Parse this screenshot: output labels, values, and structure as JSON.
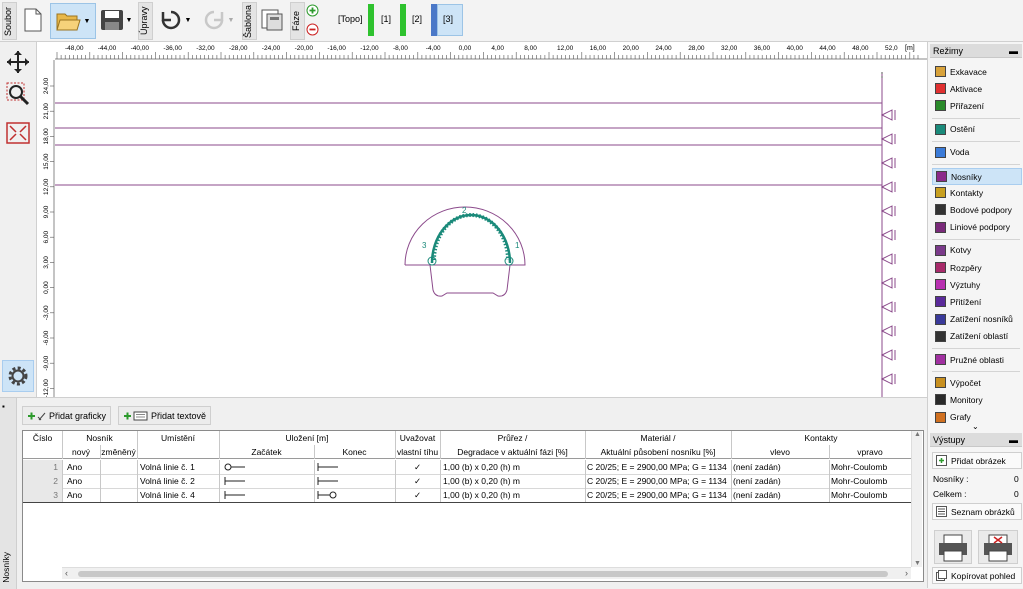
{
  "toolbar": {
    "file_label": "Soubor",
    "edit_label": "Úpravy",
    "template_label": "Šablona",
    "phase_label": "Fáze",
    "stages": [
      "[Topo]",
      "[1]",
      "[2]",
      "[3]"
    ],
    "active_stage": "[3]"
  },
  "ruler": {
    "ticks": [
      "-48,00",
      "-44,00",
      "-40,00",
      "-36,00",
      "-32,00",
      "-28,00",
      "-24,00",
      "-20,00",
      "-16,00",
      "-12,00",
      "-8,00",
      "-4,00",
      "0,00",
      "4,00",
      "8,00",
      "12,00",
      "16,00",
      "20,00",
      "24,00",
      "28,00",
      "32,00",
      "36,00",
      "40,00",
      "44,00",
      "48,00",
      "52,0"
    ],
    "unit": "[m]",
    "vticks": [
      "24,00",
      "21,00",
      "18,00",
      "15,00",
      "12,00",
      "9,00",
      "6,00",
      "3,00",
      "0,00",
      "-3,00",
      "-6,00",
      "-9,00",
      "-12,00"
    ]
  },
  "drawing": {
    "beam_labels": [
      "1",
      "2",
      "3"
    ]
  },
  "right_panel": {
    "modes_title": "Režimy",
    "modes": [
      {
        "label": "Exkavace",
        "icon": "excavation-icon"
      },
      {
        "label": "Aktivace",
        "icon": "activation-icon"
      },
      {
        "label": "Přiřazení",
        "icon": "assignment-icon"
      },
      {
        "label": "Ostění",
        "icon": "lining-icon"
      },
      {
        "label": "Voda",
        "icon": "water-icon"
      },
      {
        "label": "Nosníky",
        "icon": "beams-icon"
      },
      {
        "label": "Kontakty",
        "icon": "contacts-icon"
      },
      {
        "label": "Bodové podpory",
        "icon": "point-supports-icon"
      },
      {
        "label": "Liniové podpory",
        "icon": "line-supports-icon"
      },
      {
        "label": "Kotvy",
        "icon": "anchors-icon"
      },
      {
        "label": "Rozpěry",
        "icon": "struts-icon"
      },
      {
        "label": "Výztuhy",
        "icon": "reinforcement-icon"
      },
      {
        "label": "Přitížení",
        "icon": "surcharge-icon"
      },
      {
        "label": "Zatížení nosníků",
        "icon": "beam-load-icon"
      },
      {
        "label": "Zatížení oblastí",
        "icon": "region-load-icon"
      },
      {
        "label": "Pružné oblasti",
        "icon": "elastic-regions-icon"
      },
      {
        "label": "Výpočet",
        "icon": "analysis-icon"
      },
      {
        "label": "Monitory",
        "icon": "monitors-icon"
      },
      {
        "label": "Grafy",
        "icon": "graphs-icon"
      }
    ],
    "selected_mode": "Nosníky",
    "outputs_title": "Výstupy",
    "add_image_label": "Přidat obrázek",
    "beams_count_label": "Nosníky :",
    "beams_count": "0",
    "total_label": "Celkem :",
    "total_count": "0",
    "image_list_label": "Seznam obrázků",
    "copy_view_label": "Kopírovat pohled"
  },
  "bottom_panel": {
    "side_label": "Nosníky",
    "add_graphic_label": "Přidat graficky",
    "add_text_label": "Přidat textově",
    "headers": {
      "number": "Číslo",
      "beam": "Nosník",
      "new": "nový",
      "changed": "změněný",
      "location": "Umístění",
      "support": "Uložení [m]",
      "start": "Začátek",
      "end": "Konec",
      "consider": "Uvažovat",
      "self_weight": "vlastní tíhu",
      "section": "Průřez /",
      "degradation": "Degradace v aktuální fázi [%]",
      "material": "Materiál /",
      "current_effect": "Aktuální působení nosníku [%]",
      "contacts": "Kontakty",
      "left": "vlevo",
      "right": "vpravo"
    },
    "rows": [
      {
        "num": "1",
        "new": "Ano",
        "location": "Volná linie č. 1",
        "section": "1,00 (b) x 0,20 (h) m",
        "material": "C 20/25; E = 2900,00 MPa; G = 1134",
        "left": "(není zadán)",
        "right": "Mohr-Coulomb",
        "self_weight": "✓"
      },
      {
        "num": "2",
        "new": "Ano",
        "location": "Volná linie č. 2",
        "section": "1,00 (b) x 0,20 (h) m",
        "material": "C 20/25; E = 2900,00 MPa; G = 1134",
        "left": "(není zadán)",
        "right": "Mohr-Coulomb",
        "self_weight": "✓"
      },
      {
        "num": "3",
        "new": "Ano",
        "location": "Volná linie č. 4",
        "section": "1,00 (b) x 0,20 (h) m",
        "material": "C 20/25; E = 2900,00 MPa; G = 1134",
        "left": "(není zadán)",
        "right": "Mohr-Coulomb",
        "self_weight": "✓"
      }
    ]
  }
}
